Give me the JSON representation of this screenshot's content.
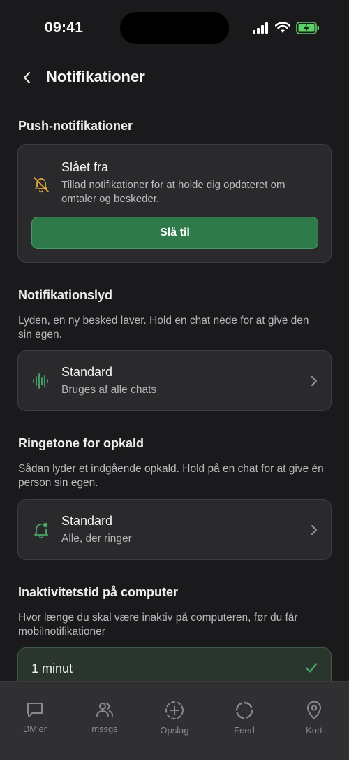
{
  "status_bar": {
    "time": "09:41"
  },
  "header": {
    "title": "Notifikationer"
  },
  "push": {
    "section_title": "Push-notifikationer",
    "state_title": "Slået fra",
    "state_desc": "Tillad notifikationer for at holde dig opdateret om omtaler og beskeder.",
    "enable_label": "Slå til"
  },
  "sound": {
    "section_title": "Notifikationslyd",
    "section_desc": "Lyden, en ny besked laver. Hold en chat nede for at give den sin egen.",
    "row_title": "Standard",
    "row_sub": "Bruges af alle chats"
  },
  "ringtone": {
    "section_title": "Ringetone for opkald",
    "section_desc": "Sådan lyder et indgående opkald. Hold på en chat for at give én person sin egen.",
    "row_title": "Standard",
    "row_sub": "Alle, der ringer"
  },
  "inactivity": {
    "section_title": "Inaktivitetstid på computer",
    "section_desc": "Hvor længe du skal være inaktiv på computeren, før du får mobilnotifikationer",
    "selected_option": "1 minut"
  },
  "tabs": [
    {
      "label": "DM'er",
      "icon": "chat-bubble-icon"
    },
    {
      "label": "mssgs",
      "icon": "people-icon"
    },
    {
      "label": "Opslag",
      "icon": "plus-circle-icon"
    },
    {
      "label": "Feed",
      "icon": "circle-icon"
    },
    {
      "label": "Kort",
      "icon": "map-pin-icon"
    }
  ],
  "colors": {
    "background": "#1a1a1c",
    "card": "#2a2a2c",
    "accent_green": "#2f7a4a",
    "warning_yellow": "#e0a83a",
    "icon_green": "#4aa86a"
  }
}
